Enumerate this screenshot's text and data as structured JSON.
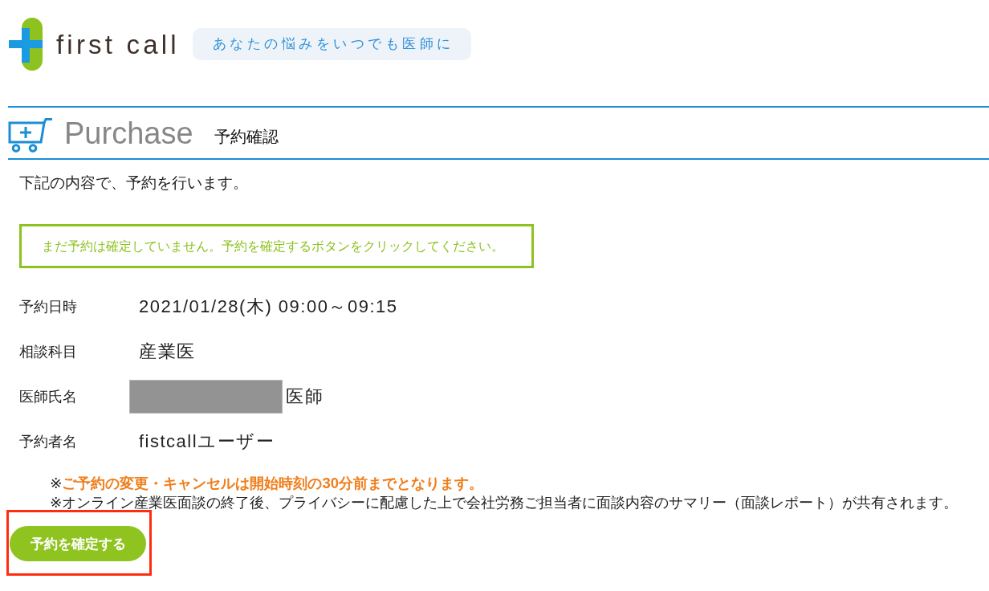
{
  "logo": {
    "wordmark": "first call",
    "tagline": "あなたの悩みをいつでも医師に"
  },
  "page_header": {
    "title": "Purchase",
    "subtitle": "予約確認"
  },
  "intro": "下記の内容で、予約を行います。",
  "notice": "まだ予約は確定していません。予約を確定するボタンをクリックしてください。",
  "details": [
    {
      "label": "予約日時",
      "value": "2021/01/28(木) 09:00～09:15",
      "redacted": false
    },
    {
      "label": "相談科目",
      "value": "産業医",
      "redacted": false
    },
    {
      "label": "医師氏名",
      "value": "医師",
      "redacted": true
    },
    {
      "label": "予約者名",
      "value": "fistcallユーザー",
      "redacted": false
    }
  ],
  "notes": [
    "※**ご予約の変更・キャンセルは開始時刻の30分前までとなります。**",
    "※オンライン産業医面談の終了後、プライバシーに配慮した上で会社労務ご担当者に面談内容のサマリー（面談レポート）が共有されます。"
  ],
  "confirm_button": {
    "label": "予約を確定する",
    "highlighted": true
  }
}
